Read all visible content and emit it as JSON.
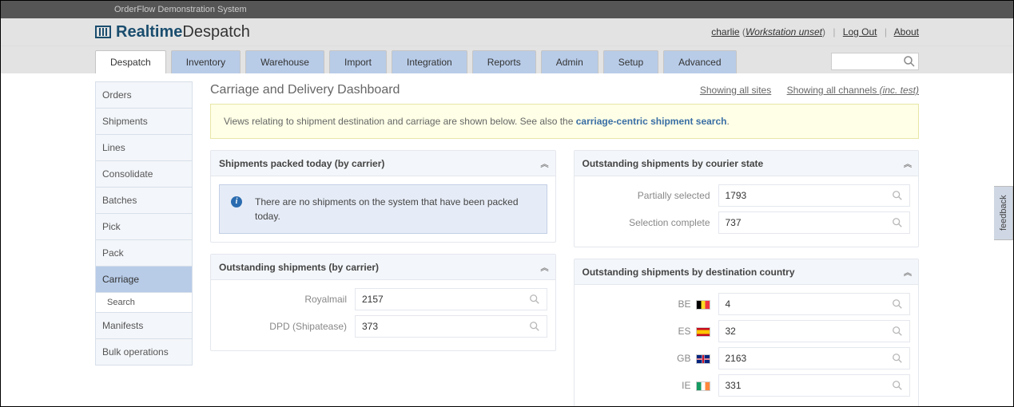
{
  "system_title": "OrderFlow Demonstration System",
  "brand": {
    "part1": "Realtime",
    "part2": "Despatch"
  },
  "user": {
    "name": "charlie",
    "workstation": "Workstation unset"
  },
  "header_links": {
    "logout": "Log Out",
    "about": "About"
  },
  "nav_tabs": [
    "Despatch",
    "Inventory",
    "Warehouse",
    "Import",
    "Integration",
    "Reports",
    "Admin",
    "Setup",
    "Advanced"
  ],
  "active_tab": "Despatch",
  "sidebar": {
    "items": [
      "Orders",
      "Shipments",
      "Lines",
      "Consolidate",
      "Batches",
      "Pick",
      "Pack",
      "Carriage",
      "Manifests",
      "Bulk operations"
    ],
    "active": "Carriage",
    "sub": "Search"
  },
  "page_title": "Carriage and Delivery Dashboard",
  "title_links": {
    "sites": "Showing all sites",
    "channels_prefix": "Showing all channels ",
    "channels_suffix": "(inc. test)"
  },
  "banner": {
    "text_before": "Views relating to shipment destination and carriage are shown below. See also the ",
    "link_text": "carriage-centric shipment search",
    "text_after": "."
  },
  "panels": {
    "packed_today": {
      "title": "Shipments packed today (by carrier)",
      "info": "There are no shipments on the system that have been packed today."
    },
    "by_carrier": {
      "title": "Outstanding shipments (by carrier)",
      "rows": [
        {
          "label": "Royalmail",
          "value": "2157"
        },
        {
          "label": "DPD (Shipatease)",
          "value": "373"
        }
      ]
    },
    "by_courier_state": {
      "title": "Outstanding shipments by courier state",
      "rows": [
        {
          "label": "Partially selected",
          "value": "1793"
        },
        {
          "label": "Selection complete",
          "value": "737"
        }
      ]
    },
    "by_country": {
      "title": "Outstanding shipments by destination country",
      "rows": [
        {
          "label": "BE",
          "flag": "be",
          "value": "4"
        },
        {
          "label": "ES",
          "flag": "es",
          "value": "32"
        },
        {
          "label": "GB",
          "flag": "gb",
          "value": "2163"
        },
        {
          "label": "IE",
          "flag": "ie",
          "value": "331"
        }
      ]
    }
  },
  "feedback_label": "feedback"
}
